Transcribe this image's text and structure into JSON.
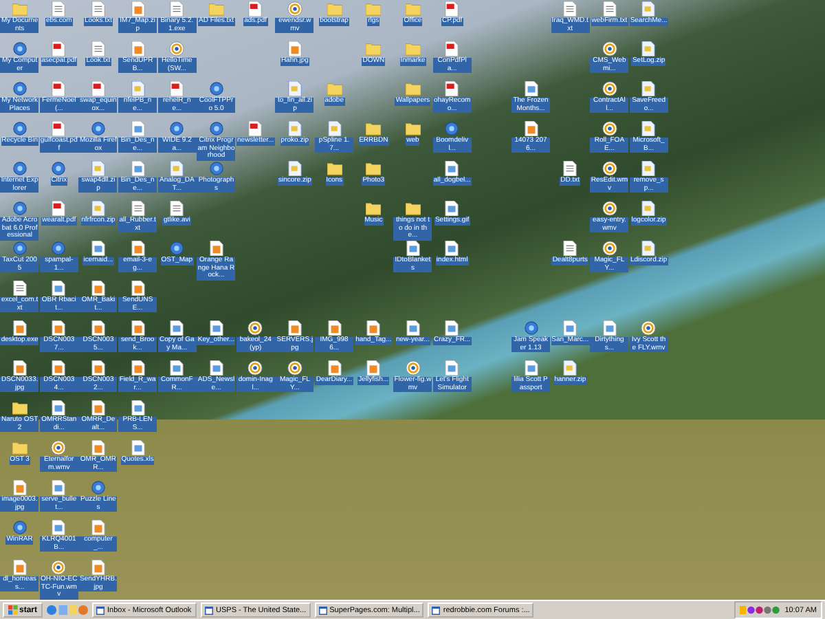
{
  "desktop": {
    "icon_columns": [
      [
        {
          "label": "My Documents",
          "kind": "folder"
        },
        {
          "label": "My Computer",
          "kind": "app"
        },
        {
          "label": "My Network Places",
          "kind": "app"
        },
        {
          "label": "Recycle Bin",
          "kind": "app"
        },
        {
          "label": "Internet Explorer",
          "kind": "app"
        },
        {
          "label": "Adobe Acrobat 6.0 Professional",
          "kind": "app"
        },
        {
          "label": "TaxCut 2005",
          "kind": "app"
        },
        {
          "label": "excel_com.txt",
          "kind": "text"
        },
        {
          "label": "desktop.exe",
          "kind": "image"
        },
        {
          "label": "DSCN0033.jpg",
          "kind": "image"
        },
        {
          "label": "Naruto OST 2",
          "kind": "folder"
        },
        {
          "label": "OST 3",
          "kind": "folder"
        },
        {
          "label": "image0003.jpg",
          "kind": "image"
        },
        {
          "label": "WinRAR",
          "kind": "app"
        },
        {
          "label": "dl_homeass...",
          "kind": "image"
        }
      ],
      [
        {
          "label": "ebs.com",
          "kind": "text"
        },
        {
          "label": "asecpal.pdf",
          "kind": "pdf"
        },
        {
          "label": "FermeNoel (...",
          "kind": "pdf"
        },
        {
          "label": "gulfcoast.pdf",
          "kind": "pdf"
        },
        {
          "label": "Citrix",
          "kind": "app"
        },
        {
          "label": "wearalt.pdf",
          "kind": "pdf"
        },
        {
          "label": "spampal-1...",
          "kind": "app"
        },
        {
          "label": "OBR Rbacit...",
          "kind": "doc"
        },
        {
          "label": "DSCN0037...",
          "kind": "image"
        },
        {
          "label": "DSCN0034...",
          "kind": "image"
        },
        {
          "label": "OMRRStandi...",
          "kind": "doc"
        },
        {
          "label": "Eternalform.wmv",
          "kind": "media"
        },
        {
          "label": "serve_bullet...",
          "kind": "doc"
        },
        {
          "label": "KLRQ4001B...",
          "kind": "doc"
        },
        {
          "label": "OH-NIO-ECTC-Fun.wmv",
          "kind": "media"
        }
      ],
      [
        {
          "label": "Looks.txt",
          "kind": "text"
        },
        {
          "label": "Look.txt",
          "kind": "text"
        },
        {
          "label": "swap_equinox...",
          "kind": "pdf"
        },
        {
          "label": "Mozilla Firefox",
          "kind": "app"
        },
        {
          "label": "swap4dll.zip",
          "kind": "zip"
        },
        {
          "label": "nfrfrcon.zip",
          "kind": "zip"
        },
        {
          "label": "icemaid...",
          "kind": "doc"
        },
        {
          "label": "OMR_Bakit...",
          "kind": "image"
        },
        {
          "label": "DSCN0035...",
          "kind": "image"
        },
        {
          "label": "DSCN0032...",
          "kind": "image"
        },
        {
          "label": "OMRR_Dealt...",
          "kind": "image"
        },
        {
          "label": "OMR_OMRR...",
          "kind": "image"
        },
        {
          "label": "Puzzle Lines",
          "kind": "app"
        },
        {
          "label": "computer_...",
          "kind": "image"
        },
        {
          "label": "SendYHRB.jpg",
          "kind": "image"
        }
      ],
      [
        {
          "label": "IM7_Map.zip",
          "kind": "image"
        },
        {
          "label": "SendUPRB...",
          "kind": "image"
        },
        {
          "label": "nfelPB_ne...",
          "kind": "zip"
        },
        {
          "label": "Bin_Des_ne...",
          "kind": "doc"
        },
        {
          "label": "Bin_Des_ne...",
          "kind": "doc"
        },
        {
          "label": "all_Rubber.txt",
          "kind": "text"
        },
        {
          "label": "email-3-eg...",
          "kind": "image"
        },
        {
          "label": "SendUNSE...",
          "kind": "image"
        },
        {
          "label": "send_Brook...",
          "kind": "image"
        },
        {
          "label": "Field_R_war...",
          "kind": "image"
        },
        {
          "label": "PRB-LENS...",
          "kind": "doc"
        },
        {
          "label": "Quotes.xls",
          "kind": "doc"
        }
      ],
      [
        {
          "label": "Binary 5.2.1.exe",
          "kind": "text"
        },
        {
          "label": "HelloTime(SW...",
          "kind": "media"
        },
        {
          "label": "rehelR_ne...",
          "kind": "pdf"
        },
        {
          "label": "WIDE 9.2a...",
          "kind": "app"
        },
        {
          "label": "Analog_DAT...",
          "kind": "zip"
        },
        {
          "label": "gtlike.avi",
          "kind": "text"
        },
        {
          "label": "OST_Map",
          "kind": "app"
        },
        null,
        {
          "label": "Copy of Gay Ma...",
          "kind": "doc"
        },
        {
          "label": "CommonFR...",
          "kind": "doc"
        }
      ],
      [
        {
          "label": "AD Files.txt",
          "kind": "folder"
        },
        null,
        {
          "label": "CoolFTPPro 5.0",
          "kind": "app"
        },
        {
          "label": "Citrix Program Neighborhood",
          "kind": "app"
        },
        {
          "label": "Photographs",
          "kind": "app"
        },
        null,
        {
          "label": "Orange Range Hana Rock...",
          "kind": "image"
        },
        null,
        {
          "label": "Key_other...",
          "kind": "doc"
        },
        {
          "label": "ADS_Newsle...",
          "kind": "doc"
        }
      ],
      [
        {
          "label": "ads.pdf",
          "kind": "pdf"
        },
        null,
        null,
        {
          "label": "newsletter...",
          "kind": "pdf"
        },
        null,
        null,
        null,
        null,
        {
          "label": "bakeol_24(yp)",
          "kind": "media"
        },
        {
          "label": "domin-Inagl...",
          "kind": "media"
        }
      ],
      [
        {
          "label": "ewendsr.wmv",
          "kind": "media"
        },
        {
          "label": "Hahn.jpg",
          "kind": "image"
        },
        {
          "label": "to_fin_all.zip",
          "kind": "zip"
        },
        {
          "label": "proko.zip",
          "kind": "zip"
        },
        {
          "label": "sincore.zip",
          "kind": "zip"
        },
        null,
        null,
        null,
        {
          "label": "SERVERS.jpg",
          "kind": "image"
        },
        {
          "label": "Magic_FLY...",
          "kind": "media"
        }
      ],
      [
        {
          "label": "bootstrap",
          "kind": "folder"
        },
        null,
        {
          "label": "adobe",
          "kind": "folder"
        },
        {
          "label": "pSpline 1.7...",
          "kind": "zip"
        },
        {
          "label": "Icons",
          "kind": "folder"
        },
        null,
        null,
        null,
        {
          "label": "IMG_9986...",
          "kind": "image"
        },
        {
          "label": "DearDiary...",
          "kind": "image"
        }
      ],
      [
        {
          "label": "rlgs",
          "kind": "folder"
        },
        {
          "label": "DOWN",
          "kind": "folder"
        },
        null,
        {
          "label": "ERRBDN",
          "kind": "folder"
        },
        {
          "label": "Photo3",
          "kind": "folder"
        },
        {
          "label": "Music",
          "kind": "folder"
        },
        null,
        null,
        {
          "label": "hand_Tag...",
          "kind": "image"
        },
        {
          "label": "Jellyfish...",
          "kind": "image"
        }
      ],
      [
        {
          "label": "Office",
          "kind": "folder"
        },
        {
          "label": "Inmarke",
          "kind": "folder"
        },
        {
          "label": "Wallpapers",
          "kind": "folder"
        },
        {
          "label": "web",
          "kind": "folder"
        },
        null,
        {
          "label": "things not to do in the...",
          "kind": "folder"
        },
        {
          "label": "IDtoBlankets",
          "kind": "doc"
        },
        null,
        {
          "label": "new-year...",
          "kind": "doc"
        },
        {
          "label": "Flower-fig.wmv",
          "kind": "media"
        }
      ],
      [
        {
          "label": "CP.pdf",
          "kind": "pdf"
        },
        {
          "label": "ConPdfPla...",
          "kind": "pdf"
        },
        {
          "label": "ohayRecomo...",
          "kind": "pdf"
        },
        {
          "label": "Boomdelivl...",
          "kind": "app"
        },
        {
          "label": "all_dogbel...",
          "kind": "doc"
        },
        {
          "label": "Settings.gif",
          "kind": "doc"
        },
        {
          "label": "index.html",
          "kind": "doc"
        },
        null,
        {
          "label": "Crazy_FR...",
          "kind": "doc"
        },
        {
          "label": "Let's Flight Simulator",
          "kind": "doc"
        }
      ],
      [],
      [
        null,
        null,
        {
          "label": "The Frozen Months...",
          "kind": "doc"
        },
        {
          "label": "14073 2076...",
          "kind": "image"
        },
        null,
        null,
        null,
        null,
        {
          "label": "Jam Speaker 1.13",
          "kind": "app"
        },
        {
          "label": "lilia Scott Passport",
          "kind": "doc"
        }
      ],
      [
        {
          "label": "Iraq_WMD.txt",
          "kind": "text"
        },
        null,
        null,
        null,
        {
          "label": "DD.txt",
          "kind": "text"
        },
        null,
        {
          "label": "Dealt8purts",
          "kind": "text"
        },
        null,
        {
          "label": "San_Marc...",
          "kind": "doc"
        },
        {
          "label": "hanner.zip",
          "kind": "zip"
        }
      ],
      [
        {
          "label": "webFirm.txt",
          "kind": "text"
        },
        {
          "label": "CMS_Webmi...",
          "kind": "media"
        },
        {
          "label": "ContractAll...",
          "kind": "media"
        },
        {
          "label": "Roll_FOAE...",
          "kind": "media"
        },
        {
          "label": "ResEdit.wmv",
          "kind": "media"
        },
        {
          "label": "easy-entry.wmv",
          "kind": "media"
        },
        {
          "label": "Magic_FLY...",
          "kind": "media"
        },
        null,
        {
          "label": "Dirtythings...",
          "kind": "doc"
        }
      ],
      [
        {
          "label": "SearchMe...",
          "kind": "zip"
        },
        {
          "label": "SetLog.zip",
          "kind": "zip"
        },
        {
          "label": "SaveFreedo...",
          "kind": "zip"
        },
        {
          "label": "Microsoft_B...",
          "kind": "zip"
        },
        {
          "label": "remove_sp...",
          "kind": "zip"
        },
        {
          "label": "logcolor.zip",
          "kind": "zip"
        },
        {
          "label": "Ldiscord.zip",
          "kind": "zip"
        },
        null,
        {
          "label": "Ivy Scott the FLY.wmv",
          "kind": "media"
        }
      ]
    ]
  },
  "taskbar": {
    "start": "start",
    "tasks": [
      {
        "label": "Inbox - Microsoft Outlook"
      },
      {
        "label": "USPS - The United State..."
      },
      {
        "label": "SuperPages.com: Multipl..."
      },
      {
        "label": "redrobbie.com Forums :..."
      }
    ],
    "clock": "10:07 AM"
  }
}
